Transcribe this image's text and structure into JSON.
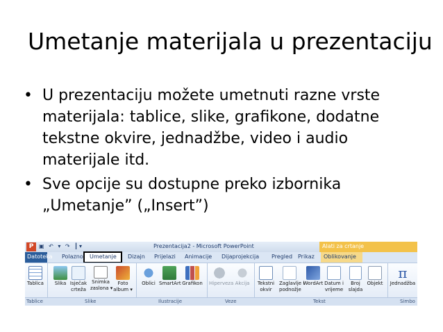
{
  "slide": {
    "title": "Umetanje materijala u prezentaciju",
    "bullet_symbol": "•",
    "bullets": [
      "U prezentaciju možete umetnuti razne vrste materijala: tablice, slike, grafikone, dodatne tekstne okvire, jednadžbe, video i audio materijale itd.",
      "Sve opcije su dostupne preko izbornika „Umetanje” („Insert”)"
    ]
  },
  "screenshot": {
    "app_logo": "P",
    "qat_icons": [
      "save-icon",
      "undo-icon",
      "redo-icon",
      "customize-icon"
    ],
    "qat_text": "▣ ↶ ▾ ↷ ┃▾",
    "window_title": "Prezentacija2 - Microsoft PowerPoint",
    "context_group_label": "Alati za crtanje",
    "tabs": {
      "datoteka": "Datoteka",
      "polazno": "Polazno",
      "umetanje": "Umetanje",
      "dizajn": "Dizajn",
      "prijelazi": "Prijelazi",
      "animacije": "Animacije",
      "dijaprojekcija": "Dijaprojekcija",
      "pregled": "Pregled",
      "prikaz": "Prikaz",
      "oblikovanje": "Oblikovanje"
    },
    "buttons": {
      "tablica": "Tablica",
      "slika": "Slika",
      "isjecak": "Isječak",
      "isjecak2": "crteža",
      "snimka": "Snimka",
      "snimka2": "zaslona ▾",
      "foto": "Foto",
      "foto2": "album ▾",
      "oblici": "Oblici",
      "smartart": "SmartArt",
      "grafikon": "Grafikon",
      "hiperveza": "Hiperveza",
      "akcija": "Akcija",
      "tekstni": "Tekstni",
      "tekstni2": "okvir",
      "zaglavlje": "Zaglavlje i",
      "zaglavlje2": "podnožje",
      "wordart": "WordArt",
      "datum": "Datum i",
      "datum2": "vrijeme",
      "broj": "Broj",
      "broj2": "slajda",
      "objekt": "Objekt",
      "jednadzba": "Jednadžba",
      "simbol": "Simbol"
    },
    "groups": {
      "tablice": "Tablice",
      "slike": "Slike",
      "ilustracije": "Ilustracije",
      "veze": "Veze",
      "tekst": "Tekst",
      "simboli": "Simbo"
    },
    "colors": {
      "file_tab": "#2a5c9a",
      "context_group": "#f3c24a",
      "ribbon": "#dfe9f5"
    }
  }
}
